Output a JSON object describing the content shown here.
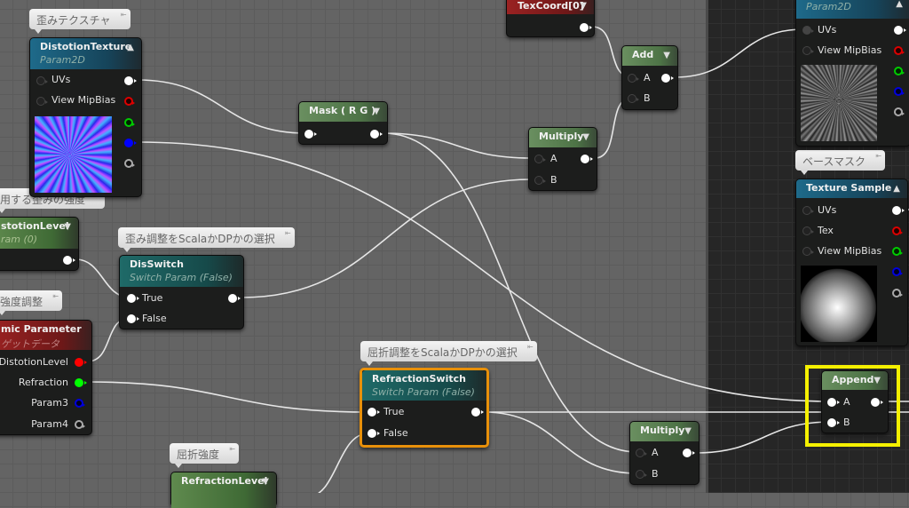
{
  "comments": {
    "distortion_texture": "歪みテクスチャ",
    "distortion_strength": "用する歪みの強度",
    "strength_adjust": "強度調整",
    "dis_select": "歪み調整をScalaかDPかの選択",
    "base_mask": "ベースマスク",
    "refraction_select": "屈折調整をScalaかDPかの選択",
    "refraction_strength": "屈折強度"
  },
  "nodes": {
    "distotion_texture": {
      "title": "DistotionTexture",
      "subtitle": "Param2D",
      "pins": [
        "UVs",
        "View MipBias"
      ]
    },
    "distotion_level": {
      "title": "stotionLevel",
      "subtitle": "ram (0)"
    },
    "dynamic_parameter": {
      "title": "mic Parameter",
      "subtitle": "ゲットデータ",
      "outputs": [
        "DistotionLevel",
        "Refraction",
        "Param3",
        "Param4"
      ]
    },
    "dis_switch": {
      "title": "DisSwitch",
      "subtitle": "Switch Param (False)",
      "pins": [
        "True",
        "False"
      ]
    },
    "mask": {
      "title": "Mask ( R G )"
    },
    "texcoord": {
      "title": "TexCoord[0]"
    },
    "add": {
      "title": "Add",
      "pins": [
        "A",
        "B"
      ]
    },
    "multiply_top": {
      "title": "Multiply",
      "pins": [
        "A",
        "B"
      ]
    },
    "right_texture": {
      "subtitle": "Param2D",
      "pins": [
        "UVs",
        "View MipBias"
      ]
    },
    "texture_sample": {
      "title": "Texture Sample",
      "pins": [
        "UVs",
        "Tex",
        "View MipBias"
      ]
    },
    "refraction_switch": {
      "title": "RefractionSwitch",
      "subtitle": "Switch Param (False)",
      "pins": [
        "True",
        "False"
      ]
    },
    "multiply_bottom": {
      "title": "Multiply",
      "pins": [
        "A",
        "B"
      ]
    },
    "append": {
      "title": "Append",
      "pins": [
        "A",
        "B"
      ]
    },
    "refraction_level": {
      "title": "RefractionLevel"
    }
  },
  "selection_color": "#f5f000",
  "selected_node_border": "#e8900a"
}
